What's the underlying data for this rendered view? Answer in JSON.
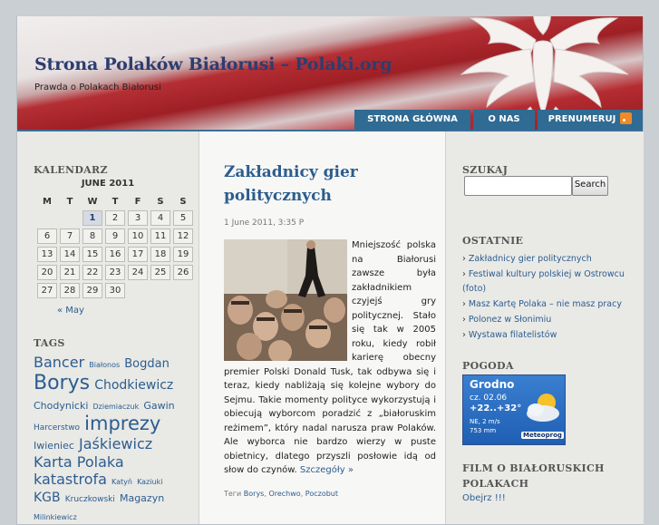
{
  "site": {
    "title": "Strona Polaków Białorusi – Polaki.org",
    "description": "Prawda o Polakach Białorusi"
  },
  "nav": [
    "STRONA GŁÓWNA",
    "O NAS",
    "PRENUMERUJ"
  ],
  "calendar": {
    "title": "KALENDARZ",
    "caption": "JUNE 2011",
    "weekdays": [
      "M",
      "T",
      "W",
      "T",
      "F",
      "S",
      "S"
    ],
    "weeks": [
      [
        "",
        "",
        "1",
        "2",
        "3",
        "4",
        "5"
      ],
      [
        "6",
        "7",
        "8",
        "9",
        "10",
        "11",
        "12"
      ],
      [
        "13",
        "14",
        "15",
        "16",
        "17",
        "18",
        "19"
      ],
      [
        "20",
        "21",
        "22",
        "23",
        "24",
        "25",
        "26"
      ],
      [
        "27",
        "28",
        "29",
        "30",
        "",
        "",
        ""
      ]
    ],
    "today": "1",
    "prev": "« May"
  },
  "tags": {
    "title": "TAGS",
    "items": [
      {
        "label": "Bancer",
        "size": 16
      },
      {
        "label": "Białonos",
        "size": 8
      },
      {
        "label": "Bogdan",
        "size": 13
      },
      {
        "label": "Borys",
        "size": 22
      },
      {
        "label": "Chodkiewicz",
        "size": 14
      },
      {
        "label": "Chodynicki",
        "size": 11
      },
      {
        "label": "Dziemiaczuk",
        "size": 8
      },
      {
        "label": "Gawin",
        "size": 11
      },
      {
        "label": "Harcerstwo",
        "size": 9
      },
      {
        "label": "imprezy",
        "size": 21
      },
      {
        "label": "Iwieniec",
        "size": 11
      },
      {
        "label": "Jaśkiewicz",
        "size": 16
      },
      {
        "label": "Karta Polaka",
        "size": 16
      },
      {
        "label": "katastrofa",
        "size": 16
      },
      {
        "label": "Katyń",
        "size": 8
      },
      {
        "label": "Kaziuki",
        "size": 8
      },
      {
        "label": "KGB",
        "size": 14
      },
      {
        "label": "Kruczkowski",
        "size": 9
      },
      {
        "label": "Magazyn",
        "size": 11
      },
      {
        "label": "Milinkiewicz",
        "size": 8
      }
    ]
  },
  "post": {
    "title": "Zakładnicy gier politycznych",
    "meta": "1 June 2011, 3:35 P",
    "body": "Mniejszość polska na Białorusi zawsze była zakładnikiem czyjejś gry politycznej. Stało się tak w 2005 roku, kiedy robił karierę obecny premier Polski Donald Tusk, tak odbywa się i teraz, kiedy nabliżają się kolejne wybory do Sejmu. Takie momenty polityce wykorzystują i obiecują wyborcom poradzić z „białoruskim reżimem”, który nadal narusza praw Polaków. Ale wyborca nie bardzo wierzy w puste obietnicy, dlatego przyszli posłowie idą od słow do czynów.",
    "more": "Szczegóły »",
    "tags_label": "Теги",
    "tags": [
      "Borys",
      "Orechwo",
      "Poczobut"
    ]
  },
  "search": {
    "title": "SZUKAJ",
    "button": "Search",
    "value": ""
  },
  "recent": {
    "title": "OSTATNIE",
    "items": [
      "Zakładnicy gier politycznych",
      "Festiwal kultury polskiej w Ostrowcu (foto)",
      "Masz Kartę Polaka – nie masz pracy",
      "Polonez w Słonimiu",
      "Wystawa filatelistów"
    ]
  },
  "weather": {
    "title": "POGODA",
    "city": "Grodno",
    "date": "cz. 02.06",
    "temp": "+22..+32°",
    "wind": "NE, 2 m/s",
    "pressure": "753 mm",
    "brand": "Meteoprog"
  },
  "film": {
    "title": "FILM O BIAŁORUSKICH POLAKACH",
    "link": "Obejrz !!!"
  },
  "colors": {
    "accent": "#2c5d8f",
    "nav": "#2f6b93",
    "title": "#2c3d70",
    "flag_red": "#b42f34"
  }
}
